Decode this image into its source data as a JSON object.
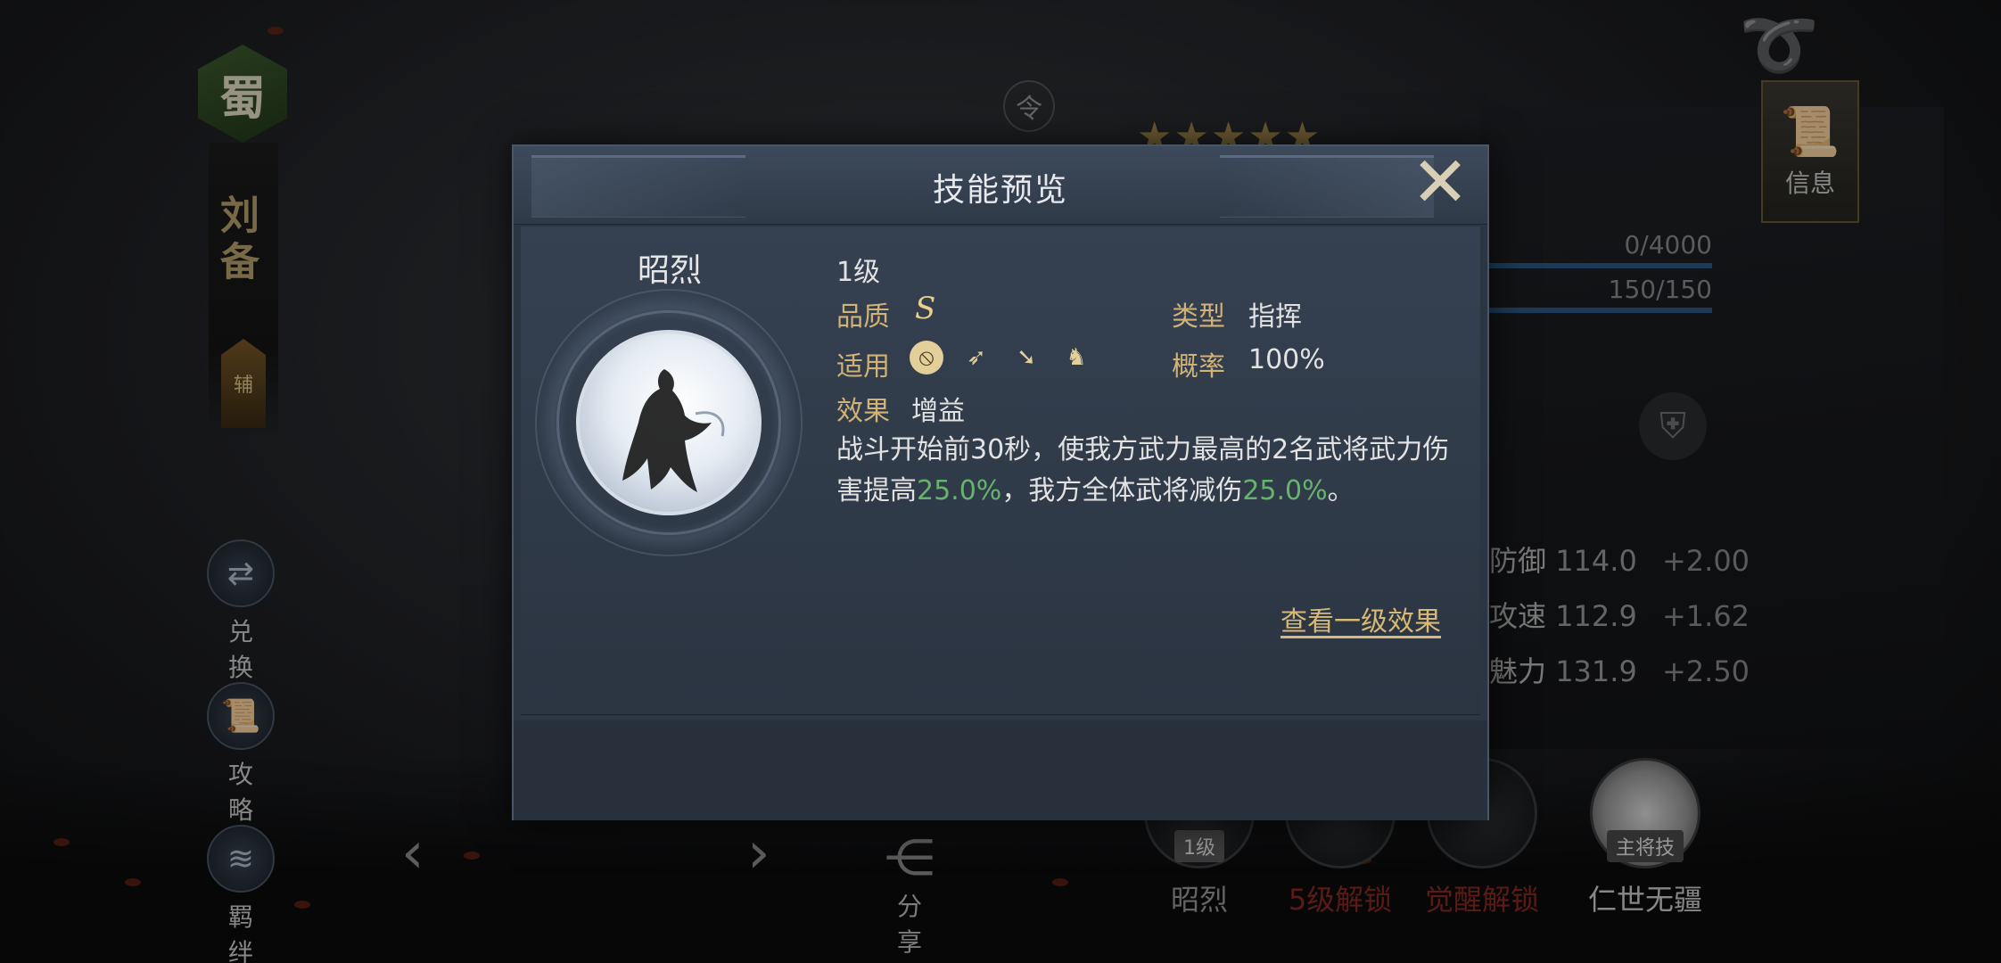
{
  "background": {
    "faction": "蜀",
    "hero_name": "刘备",
    "role_tag": "辅",
    "side_menu": [
      {
        "label": "兑 换",
        "icon": "exchange-icon"
      },
      {
        "label": "攻 略",
        "icon": "scroll-icon"
      },
      {
        "label": "羁 绊",
        "icon": "bond-icon"
      }
    ],
    "token_label": "令",
    "share_label": "分 享",
    "info_tab_label": "信息",
    "exp_text": "0/4000",
    "energy_text": "150/150",
    "stats": [
      {
        "name": "防御",
        "value": "114.0",
        "bonus": "+2.00"
      },
      {
        "name": "攻速",
        "value": "112.9",
        "bonus": "+1.62"
      },
      {
        "name": "魅力",
        "value": "131.9",
        "bonus": "+2.50"
      }
    ],
    "skill_slots": [
      {
        "label": "昭烈",
        "tag": "1级",
        "color": "#9a9a9a"
      },
      {
        "label": "5级解锁",
        "tag": "",
        "color": "#8a2a24"
      },
      {
        "label": "觉醒解锁",
        "tag": "",
        "color": "#8a2a24"
      },
      {
        "label": "仁世无疆",
        "tag": "主将技",
        "color": "#cfcfcf"
      }
    ]
  },
  "modal": {
    "title": "技能预览",
    "close_icon": "crossed-swords-close-icon",
    "skill_name": "昭烈",
    "level": "1级",
    "quality_label": "品质",
    "quality_value": "S",
    "type_label": "类型",
    "type_value": "指挥",
    "applicable_label": "适用",
    "applicable_icons": [
      "shield-icon",
      "bow-icon",
      "spear-icon",
      "horse-icon"
    ],
    "chance_label": "概率",
    "chance_value": "100%",
    "effect_label": "效果",
    "effect_value": "增益",
    "description": {
      "part1": "战斗开始前30秒，使我方武力最高的2名武将武力伤害提高",
      "hl1": "25.0%",
      "part2": "，我方全体武将减伤",
      "hl2": "25.0%",
      "part3": "。"
    },
    "view_link": "查看一级效果"
  },
  "colors": {
    "accent_gold": "#d1b277",
    "highlight_green": "#66b36e",
    "locked_red": "#8a2a24"
  }
}
